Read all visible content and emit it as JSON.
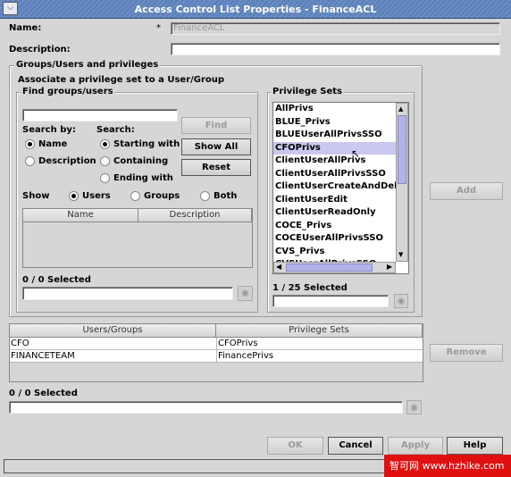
{
  "window": {
    "title": "Access Control List Properties - FinanceACL"
  },
  "form": {
    "name_label": "Name:",
    "required_mark": "*",
    "name_value": "FinanceACL",
    "description_label": "Description:",
    "description_value": ""
  },
  "groups_section": {
    "legend": "Groups/Users and privileges",
    "instruction": "Associate a privilege set to a User/Group"
  },
  "find": {
    "legend": "Find groups/users",
    "search_value": "",
    "search_by_label": "Search by:",
    "search_label": "Search:",
    "search_by_options": [
      {
        "label": "Name",
        "selected": true
      },
      {
        "label": "Description",
        "selected": false
      }
    ],
    "search_options": [
      {
        "label": "Starting with",
        "selected": true
      },
      {
        "label": "Containing",
        "selected": false
      },
      {
        "label": "Ending with",
        "selected": false
      }
    ],
    "find_button": "Find",
    "show_all_button": "Show All",
    "reset_button": "Reset",
    "show_label": "Show",
    "show_options": [
      {
        "label": "Users",
        "selected": true
      },
      {
        "label": "Groups",
        "selected": false
      },
      {
        "label": "Both",
        "selected": false
      }
    ],
    "columns": [
      "Name",
      "Description"
    ],
    "selected_count": "0 / 0 Selected",
    "filter_value": ""
  },
  "privilege_sets": {
    "legend": "Privilege Sets",
    "items": [
      "AllPrivs",
      "BLUE_Privs",
      "BLUEUserAllPrivsSSO",
      "CFOPrivs",
      "ClientUserAllPrivs",
      "ClientUserAllPrivsSSO",
      "ClientUserCreateAndDelet",
      "ClientUserEdit",
      "ClientUserReadOnly",
      "COCE_Privs",
      "COCEUserAllPrivsSSO",
      "CVS_Privs",
      "CVSUserAllPrivsSSO"
    ],
    "selected_item": "CFOPrivs",
    "selected_count": "1 / 25 Selected",
    "filter_value": ""
  },
  "add_button": "Add",
  "remove_button": "Remove",
  "assignments": {
    "columns": [
      "Users/Groups",
      "Privilege Sets"
    ],
    "rows": [
      [
        "CFO",
        "CFOPrivs"
      ],
      [
        "FINANCETEAM",
        "FinancePrivs"
      ]
    ],
    "selected_count": "0 / 0 Selected",
    "filter_value": ""
  },
  "footer": {
    "ok": "OK",
    "cancel": "Cancel",
    "apply": "Apply",
    "help": "Help"
  },
  "watermark": "智可网 www.hzhike.com",
  "colors": {
    "title_bar": "#5b80b8",
    "selection": "#c8c8f0",
    "background": "#d6d6d6"
  }
}
